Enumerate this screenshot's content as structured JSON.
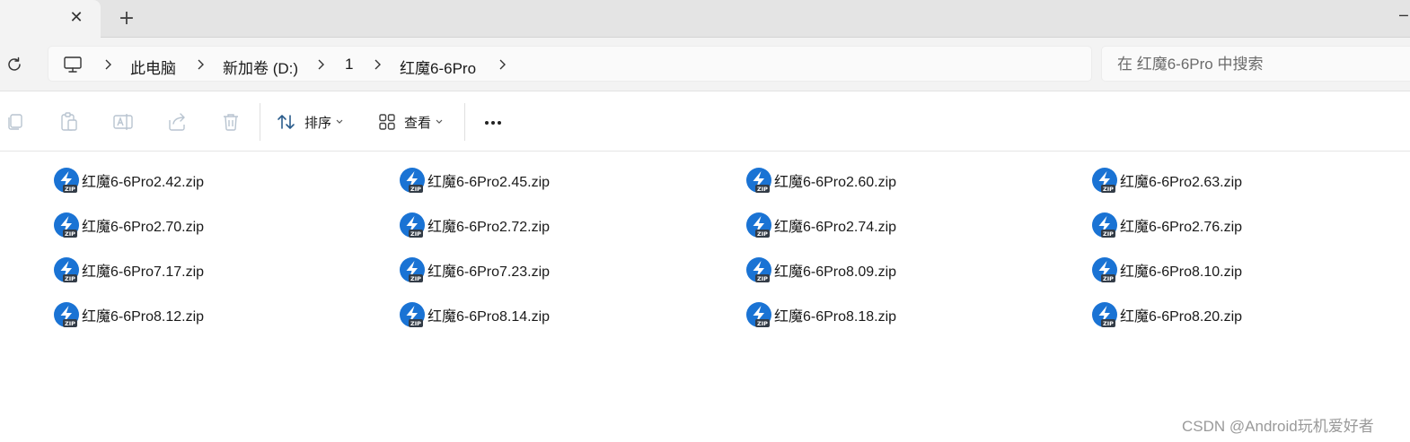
{
  "tab": {
    "close_glyph": "✕",
    "new_tab_glyph": "+"
  },
  "window": {
    "minimize_glyph": "─"
  },
  "address": {
    "crumbs": [
      "此电脑",
      "新加卷 (D:)",
      "1",
      "红魔6-6Pro"
    ]
  },
  "search": {
    "placeholder": "在 红魔6-6Pro 中搜索"
  },
  "toolbar": {
    "sort_label": "排序",
    "view_label": "查看"
  },
  "files": [
    [
      "红魔6-6Pro2.42.zip",
      "红魔6-6Pro2.45.zip",
      "红魔6-6Pro2.60.zip",
      "红魔6-6Pro2.63.zip"
    ],
    [
      "红魔6-6Pro2.70.zip",
      "红魔6-6Pro2.72.zip",
      "红魔6-6Pro2.74.zip",
      "红魔6-6Pro2.76.zip"
    ],
    [
      "红魔6-6Pro7.17.zip",
      "红魔6-6Pro7.23.zip",
      "红魔6-6Pro8.09.zip",
      "红魔6-6Pro8.10.zip"
    ],
    [
      "红魔6-6Pro8.12.zip",
      "红魔6-6Pro8.14.zip",
      "红魔6-6Pro8.18.zip",
      "红魔6-6Pro8.20.zip"
    ]
  ],
  "icons": {
    "file_icon": "zip-archive-icon",
    "accent": "#1a73d4"
  },
  "watermark": "CSDN @Android玩机爱好者"
}
